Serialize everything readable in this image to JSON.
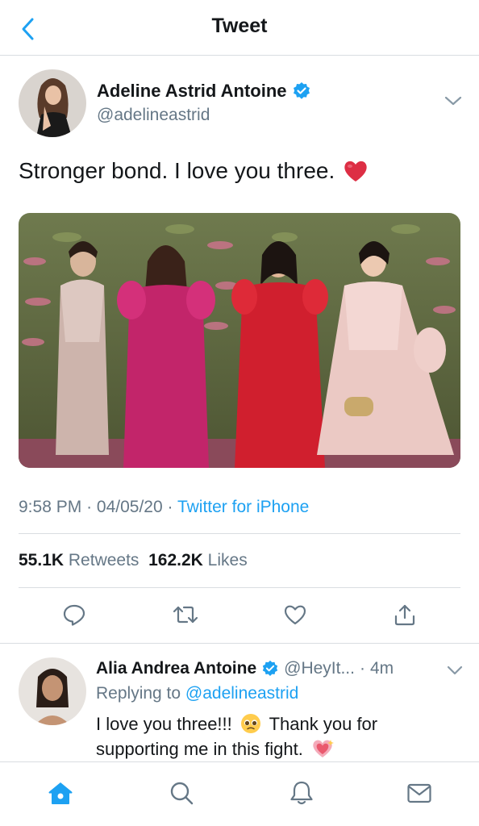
{
  "header": {
    "title": "Tweet",
    "back_icon": "chevron-left-icon"
  },
  "tweet": {
    "author_name": "Adeline Astrid Antoine",
    "author_handle": "@adelineastrid",
    "verified": true,
    "text": "Stronger bond. I love you three.",
    "emoji": "heart-icon",
    "time": "9:58 PM",
    "date": "04/05/20",
    "source": "Twitter for iPhone",
    "retweets_count": "55.1K",
    "retweets_label": "Retweets",
    "likes_count": "162.2K",
    "likes_label": "Likes"
  },
  "reply": {
    "author_name": "Alia Andrea Antoine",
    "author_handle": "@HeyIt...",
    "time_ago": "4m",
    "replying_label": "Replying to",
    "replying_handle": "@adelineastrid",
    "text_part1": "I love you three!!!",
    "text_part2": "Thank you for supporting me in this fight."
  },
  "nav": [
    "home-icon",
    "search-icon",
    "notifications-icon",
    "messages-icon"
  ],
  "colors": {
    "accent": "#1da1f2",
    "muted": "#657786",
    "heart": "#e0245e"
  }
}
